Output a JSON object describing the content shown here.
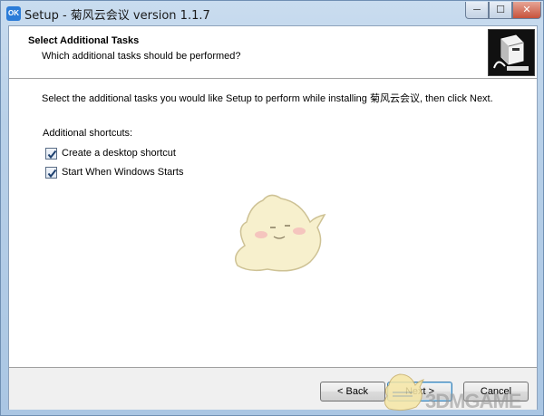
{
  "window": {
    "title": "Setup - 菊风云会议 version 1.1.7",
    "app_icon_text": "OK",
    "min_glyph": "─",
    "max_glyph": "☐",
    "close_glyph": "✕"
  },
  "header": {
    "title": "Select Additional Tasks",
    "subtitle": "Which additional tasks should be performed?",
    "image_icon": "computer-disk-icon"
  },
  "content": {
    "description": "Select the additional tasks you would like Setup to perform while installing 菊风云会议, then click Next.",
    "shortcuts_label": "Additional shortcuts:",
    "tasks": [
      {
        "label": "Create a desktop shortcut",
        "checked": true
      },
      {
        "label": "Start When Windows Starts",
        "checked": true
      }
    ]
  },
  "footer": {
    "back_label": "< Back",
    "next_label": "Next >",
    "cancel_label": "Cancel"
  },
  "watermark": {
    "text": "3DMGAME"
  },
  "colors": {
    "accent": "#2b7cd8",
    "frame": "#b8d0e8"
  }
}
